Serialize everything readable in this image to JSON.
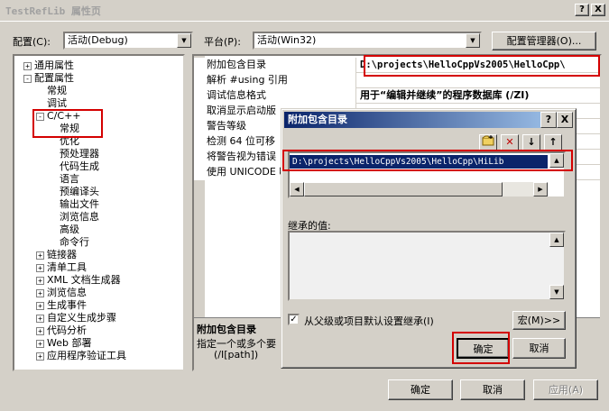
{
  "window": {
    "title": "TestRefLib 属性页",
    "help_button": "?",
    "close_button": "X"
  },
  "toolbar": {
    "config_label": "配置(C):",
    "config_value": "活动(Debug)",
    "platform_label": "平台(P):",
    "platform_value": "活动(Win32)",
    "config_manager_label": "配置管理器(O)..."
  },
  "tree": {
    "items": [
      {
        "label": "通用属性",
        "level": 0,
        "expander": "+"
      },
      {
        "label": "配置属性",
        "level": 0,
        "expander": "-"
      },
      {
        "label": "常规",
        "level": 1,
        "expander": ""
      },
      {
        "label": "调试",
        "level": 1,
        "expander": ""
      },
      {
        "label": "C/C++",
        "level": 1,
        "expander": "-"
      },
      {
        "label": "常规",
        "level": 2,
        "expander": ""
      },
      {
        "label": "优化",
        "level": 2,
        "expander": ""
      },
      {
        "label": "预处理器",
        "level": 2,
        "expander": ""
      },
      {
        "label": "代码生成",
        "level": 2,
        "expander": ""
      },
      {
        "label": "语言",
        "level": 2,
        "expander": ""
      },
      {
        "label": "预编译头",
        "level": 2,
        "expander": ""
      },
      {
        "label": "输出文件",
        "level": 2,
        "expander": ""
      },
      {
        "label": "浏览信息",
        "level": 2,
        "expander": ""
      },
      {
        "label": "高级",
        "level": 2,
        "expander": ""
      },
      {
        "label": "命令行",
        "level": 2,
        "expander": ""
      },
      {
        "label": "链接器",
        "level": 1,
        "expander": "+"
      },
      {
        "label": "清单工具",
        "level": 1,
        "expander": "+"
      },
      {
        "label": "XML 文档生成器",
        "level": 1,
        "expander": "+"
      },
      {
        "label": "浏览信息",
        "level": 1,
        "expander": "+"
      },
      {
        "label": "生成事件",
        "level": 1,
        "expander": "+"
      },
      {
        "label": "自定义生成步骤",
        "level": 1,
        "expander": "+"
      },
      {
        "label": "代码分析",
        "level": 1,
        "expander": "+"
      },
      {
        "label": "Web 部署",
        "level": 1,
        "expander": "+"
      },
      {
        "label": "应用程序验证工具",
        "level": 1,
        "expander": "+"
      }
    ]
  },
  "grid": {
    "rows": [
      {
        "name": "附加包含目录",
        "value": "D:\\projects\\HelloCppVs2005\\HelloCpp\\"
      },
      {
        "name": "解析 #using 引用",
        "value": ""
      },
      {
        "name": "调试信息格式",
        "value": "用于“编辑并继续”的程序数据库 (/ZI)"
      },
      {
        "name": "取消显示启动版",
        "value": ""
      },
      {
        "name": "警告等级",
        "value": ""
      },
      {
        "name": "检测 64 位可移",
        "value": ""
      },
      {
        "name": "将警告视为错误",
        "value": ""
      },
      {
        "name": "使用 UNICODE 响",
        "value": ""
      }
    ],
    "desc_title": "附加包含目录",
    "desc_text": "指定一个或多个要",
    "desc_switch": "(/I[path])"
  },
  "modal": {
    "title": "附加包含目录",
    "help_button": "?",
    "close_button": "X",
    "list_item": "D:\\projects\\HelloCppVs2005\\HelloCpp\\HiLib",
    "inherited_label": "继承的值:",
    "inherit_checkbox_label": "从父级或项目默认设置继承(I)",
    "macro_button": "宏(M)>>",
    "ok_button": "确定",
    "cancel_button": "取消"
  },
  "footer": {
    "ok_button": "确定",
    "cancel_button": "取消",
    "apply_button": "应用(A)"
  }
}
